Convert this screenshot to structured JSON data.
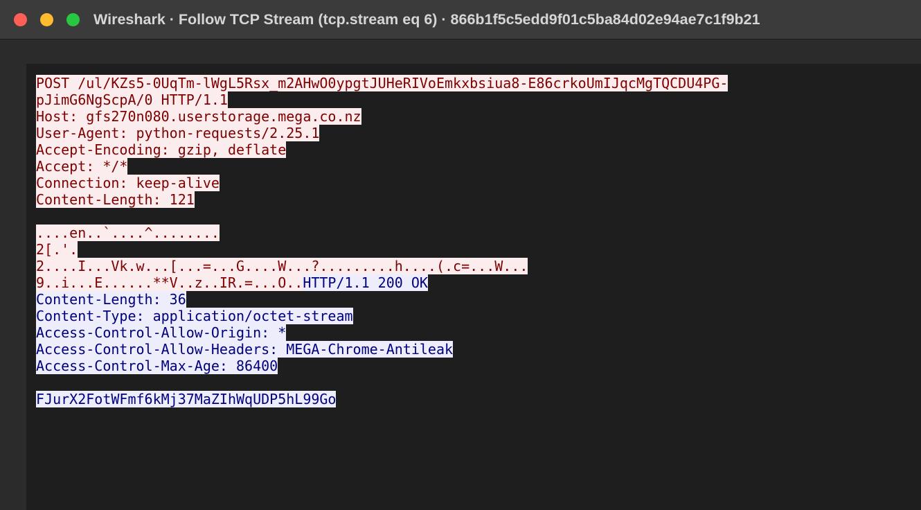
{
  "window": {
    "title": "Wireshark · Follow TCP Stream (tcp.stream eq 6) · 866b1f5c5edd9f01c5ba84d02e94ae7c1f9b21"
  },
  "colors": {
    "client_bg": "#fbeded",
    "client_fg": "#7f0000",
    "server_bg": "#ededfb",
    "server_fg": "#00007f",
    "pane_bg": "#1e1e1e"
  },
  "stream": {
    "lines": [
      {
        "segments": [
          {
            "dir": "client",
            "text": "POST /ul/KZs5-0UqTm-lWgL5Rsx_m2AHwO0ypgtJUHeRIVoEmkxbsiua8-E86crkoUmIJqcMgTQCDU4PG-"
          }
        ]
      },
      {
        "segments": [
          {
            "dir": "client",
            "text": "pJimG6NgScpA/0 HTTP/1.1"
          }
        ]
      },
      {
        "segments": [
          {
            "dir": "client",
            "text": "Host: gfs270n080.userstorage.mega.co.nz"
          }
        ]
      },
      {
        "segments": [
          {
            "dir": "client",
            "text": "User-Agent: python-requests/2.25.1"
          }
        ]
      },
      {
        "segments": [
          {
            "dir": "client",
            "text": "Accept-Encoding: gzip, deflate"
          }
        ]
      },
      {
        "segments": [
          {
            "dir": "client",
            "text": "Accept: */*"
          }
        ]
      },
      {
        "segments": [
          {
            "dir": "client",
            "text": "Connection: keep-alive"
          }
        ]
      },
      {
        "segments": [
          {
            "dir": "client",
            "text": "Content-Length: 121"
          }
        ]
      },
      {
        "segments": []
      },
      {
        "segments": [
          {
            "dir": "client",
            "text": "....en..`....^........"
          }
        ]
      },
      {
        "segments": [
          {
            "dir": "client",
            "text": "2[.'."
          }
        ]
      },
      {
        "segments": [
          {
            "dir": "client",
            "text": "2....I...Vk.w...[...=...G....W...?.........h....(.c=...W..."
          }
        ]
      },
      {
        "segments": [
          {
            "dir": "client",
            "text": "9..i...E......**V..z..IR.=...O.."
          },
          {
            "dir": "server",
            "text": "HTTP/1.1 200 OK"
          }
        ]
      },
      {
        "segments": [
          {
            "dir": "server",
            "text": "Content-Length: 36"
          }
        ]
      },
      {
        "segments": [
          {
            "dir": "server",
            "text": "Content-Type: application/octet-stream"
          }
        ]
      },
      {
        "segments": [
          {
            "dir": "server",
            "text": "Access-Control-Allow-Origin: *"
          }
        ]
      },
      {
        "segments": [
          {
            "dir": "server",
            "text": "Access-Control-Allow-Headers: MEGA-Chrome-Antileak"
          }
        ]
      },
      {
        "segments": [
          {
            "dir": "server",
            "text": "Access-Control-Max-Age: 86400"
          }
        ]
      },
      {
        "segments": []
      },
      {
        "segments": [
          {
            "dir": "server",
            "text": "FJurX2FotWFmf6kMj37MaZIhWqUDP5hL99Go"
          }
        ]
      }
    ]
  }
}
